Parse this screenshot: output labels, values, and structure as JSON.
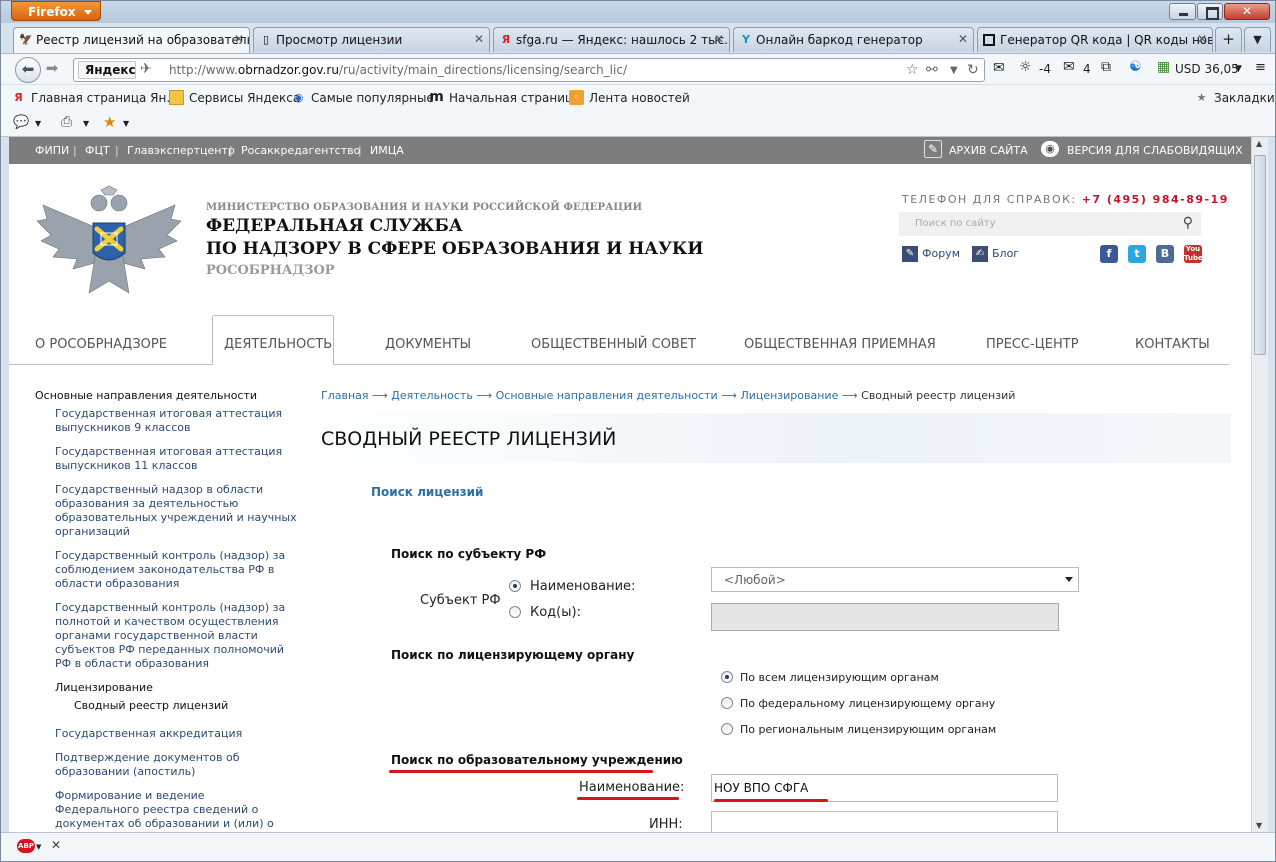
{
  "browser": {
    "menu_label": "Firefox",
    "tabs": [
      {
        "title": "Реестр лицензий на образователь...",
        "icon": "eagle-favicon",
        "active": true
      },
      {
        "title": "Просмотр лицензии",
        "icon": "page-favicon"
      },
      {
        "title": "sfga.ru — Яндекс: нашлось 2 тыс. ...",
        "icon": "yandex-favicon"
      },
      {
        "title": "Онлайн баркод генератор",
        "icon": "barcode-favicon"
      },
      {
        "title": "Генератор QR кода | QR коды нов...",
        "icon": "qr-favicon"
      }
    ],
    "new_tab": "+",
    "yandex_badge": "Яндекс",
    "url_host_prefix": "http://www.",
    "url_host": "obrnadzor.gov.ru",
    "url_path": "/ru/activity/main_directions/licensing/search_lic/",
    "weather": "-4",
    "mail_count": "4",
    "currency": "USD 36,05",
    "bookmarks": [
      {
        "label": "Главная страница Ян...",
        "icon": "yandex-icon"
      },
      {
        "label": "Сервисы Яндекса",
        "icon": "folder-icon"
      },
      {
        "label": "Самые популярные",
        "icon": "popular-icon"
      },
      {
        "label": "Начальная страница",
        "icon": "m-icon"
      },
      {
        "label": "Лента новостей",
        "icon": "rss-icon"
      }
    ],
    "bookmarks_menu": "Закладки"
  },
  "site": {
    "toplinks": [
      "ФИПИ",
      "ФЦТ",
      "Главэкспертцентр",
      "Росаккредагентство",
      "ИМЦА"
    ],
    "archive": "АРХИВ САЙТА",
    "accessible": "ВЕРСИЯ ДЛЯ СЛАБОВИДЯЩИХ",
    "ministry": "МИНИСТЕРСТВО ОБРАЗОВАНИЯ И НАУКИ РОССИЙСКОЙ ФЕДЕРАЦИИ",
    "service_line1": "ФЕДЕРАЛЬНАЯ СЛУЖБА",
    "service_line2": "ПО НАДЗОРУ В СФЕРЕ ОБРАЗОВАНИЯ И НАУКИ",
    "short_name": "РОСОБРНАДЗОР",
    "phone_label": "ТЕЛЕФОН ДЛЯ СПРАВОК:",
    "phone": "+7 (495) 984-89-19",
    "search_placeholder": "Поиск по сайту",
    "forum": "Форум",
    "blog": "Блог",
    "social": [
      "facebook-icon",
      "twitter-icon",
      "vk-icon",
      "youtube-icon"
    ],
    "menu": [
      "О РОСОБРНАДЗОРЕ",
      "ДЕЯТЕЛЬНОСТЬ",
      "ДОКУМЕНТЫ",
      "ОБЩЕСТВЕННЫЙ СОВЕТ",
      "ОБЩЕСТВЕННАЯ ПРИЕМНАЯ",
      "ПРЕСС-ЦЕНТР",
      "КОНТАКТЫ"
    ],
    "leftnav": {
      "heading": "Основные направления деятельности",
      "items": [
        [
          "Государственная итоговая аттестация",
          "выпускников 9 классов"
        ],
        [
          "Государственная итоговая аттестация",
          "выпускников 11 классов"
        ],
        [
          "Государственный надзор в области",
          "образования за деятельностью",
          "образовательных учреждений и научных",
          "организаций"
        ],
        [
          "Государственный контроль (надзор) за",
          "соблюдением законодательства РФ в",
          "области образования"
        ],
        [
          "Государственный контроль (надзор) за",
          "полнотой и качеством осуществления",
          "органами государственной власти",
          "субъектов РФ переданных полномочий",
          "РФ в области образования"
        ]
      ],
      "licensing": "Лицензирование",
      "registry": "Сводный реестр лицензий",
      "items2": [
        [
          "Государственная аккредитация"
        ],
        [
          "Подтверждение документов об",
          "образовании (апостиль)"
        ],
        [
          "Формирование и ведение",
          "Федерального реестра сведений о",
          "документах об образовании и (или) о"
        ]
      ]
    },
    "breadcrumb": [
      "Главная",
      "Деятельность",
      "Основные направления деятельности",
      "Лицензирование",
      "Сводный реестр лицензий"
    ],
    "breadcrumb_sep": "⟶",
    "title": "СВОДНЫЙ РЕЕСТР ЛИЦЕНЗИЙ",
    "search_link": "Поиск лицензий",
    "subject": {
      "heading": "Поиск по субъекту РФ",
      "label": "Субъект РФ",
      "opt_name": "Наименование:",
      "opt_code": "Код(ы):",
      "select_value": "<Любой>"
    },
    "organ": {
      "heading": "Поиск по лицензирующему органу",
      "options": [
        "По всем лицензирующим органам",
        "По федеральному лицензирующему органу",
        "По региональным лицензирующим органам"
      ]
    },
    "institution": {
      "heading": "Поиск по образовательному учреждению",
      "name_label": "Наименование:",
      "name_value": "НОУ ВПО СФГА",
      "inn_label": "ИНН:"
    }
  },
  "colors": {
    "accent_red": "#d8121e",
    "link_blue": "#2d6fa8",
    "gray_strip": "#7d7d7d"
  }
}
